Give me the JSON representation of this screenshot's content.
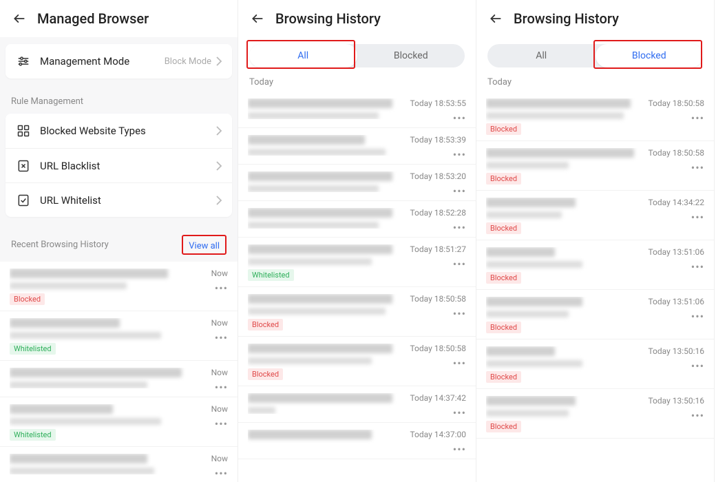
{
  "pane1": {
    "title": "Managed Browser",
    "mgmt_mode": {
      "label": "Management Mode",
      "value": "Block Mode"
    },
    "rule_section": "Rule Management",
    "rows": {
      "blocked_types": "Blocked Website Types",
      "blacklist": "URL Blacklist",
      "whitelist": "URL Whitelist"
    },
    "recent": {
      "label": "Recent Browsing History",
      "viewall": "View all"
    },
    "items": [
      {
        "time": "Now",
        "tag": "Blocked",
        "w1": 230,
        "w2": 170
      },
      {
        "time": "Now",
        "tag": "Whitelisted",
        "w1": 160,
        "w2": 220
      },
      {
        "time": "Now",
        "tag": "",
        "w1": 250,
        "w2": 200
      },
      {
        "time": "Now",
        "tag": "Whitelisted",
        "w1": 150,
        "w2": 220
      },
      {
        "time": "Now",
        "tag": "",
        "w1": 200,
        "w2": 210
      }
    ]
  },
  "pane2": {
    "title": "Browsing History",
    "tabs": {
      "all": "All",
      "blocked": "Blocked",
      "active": "all"
    },
    "today": "Today",
    "items": [
      {
        "time": "Today 18:53:55",
        "tag": "",
        "w1": 210,
        "w2": 190
      },
      {
        "time": "Today 18:53:39",
        "tag": "",
        "w1": 170,
        "w2": 200
      },
      {
        "time": "Today 18:53:20",
        "tag": "",
        "w1": 210,
        "w2": 190
      },
      {
        "time": "Today 18:52:28",
        "tag": "",
        "w1": 210,
        "w2": 190
      },
      {
        "time": "Today 18:51:27",
        "tag": "Whitelisted",
        "w1": 210,
        "w2": 180
      },
      {
        "time": "Today 18:50:58",
        "tag": "Blocked",
        "w1": 210,
        "w2": 200
      },
      {
        "time": "Today 18:50:58",
        "tag": "Blocked",
        "w1": 210,
        "w2": 180
      },
      {
        "time": "Today 14:37:42",
        "tag": "",
        "w1": 210,
        "w2": 40
      },
      {
        "time": "Today 14:37:00",
        "tag": "",
        "w1": 180,
        "w2": 0
      }
    ]
  },
  "pane3": {
    "title": "Browsing History",
    "tabs": {
      "all": "All",
      "blocked": "Blocked",
      "active": "blocked"
    },
    "today": "Today",
    "items": [
      {
        "time": "Today 18:50:58",
        "tag": "Blocked",
        "w1": 210,
        "w2": 200
      },
      {
        "time": "Today 18:50:58",
        "tag": "Blocked",
        "w1": 215,
        "w2": 120
      },
      {
        "time": "Today 14:34:22",
        "tag": "Blocked",
        "w1": 130,
        "w2": 110
      },
      {
        "time": "Today 13:51:06",
        "tag": "Blocked",
        "w1": 100,
        "w2": 140
      },
      {
        "time": "Today 13:51:06",
        "tag": "Blocked",
        "w1": 140,
        "w2": 120
      },
      {
        "time": "Today 13:50:16",
        "tag": "Blocked",
        "w1": 100,
        "w2": 140
      },
      {
        "time": "Today 13:50:16",
        "tag": "Blocked",
        "w1": 130,
        "w2": 120
      }
    ]
  },
  "tags": {
    "Blocked": "tag-blocked",
    "Whitelisted": "tag-white"
  }
}
